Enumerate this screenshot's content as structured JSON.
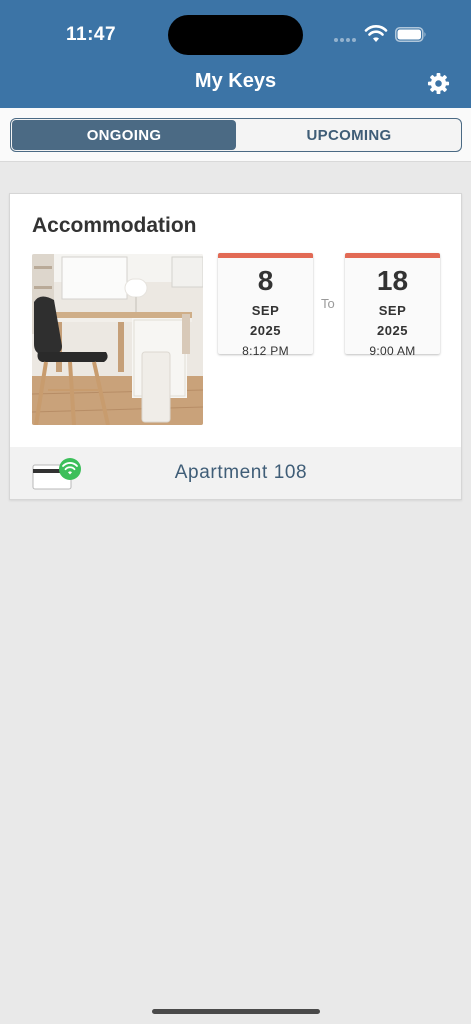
{
  "status_bar": {
    "time": "11:47"
  },
  "header": {
    "title": "My Keys",
    "settings_icon": "gear-icon"
  },
  "tabs": [
    {
      "label": "ONGOING",
      "active": true
    },
    {
      "label": "UPCOMING",
      "active": false
    }
  ],
  "booking": {
    "title": "Accommodation",
    "checkin": {
      "day": "8",
      "month": "SEP",
      "year": "2025",
      "time": "8:12 PM"
    },
    "separator": "To",
    "checkout": {
      "day": "18",
      "month": "SEP",
      "year": "2025",
      "time": "9:00 AM"
    },
    "key": {
      "name": "Apartment 108",
      "icon": "mobile-key-card-icon"
    }
  },
  "colors": {
    "header": "#3c74a6",
    "segment_active": "#4b6a84",
    "date_accent": "#e26a55",
    "key_badge": "#3cbf5a"
  }
}
